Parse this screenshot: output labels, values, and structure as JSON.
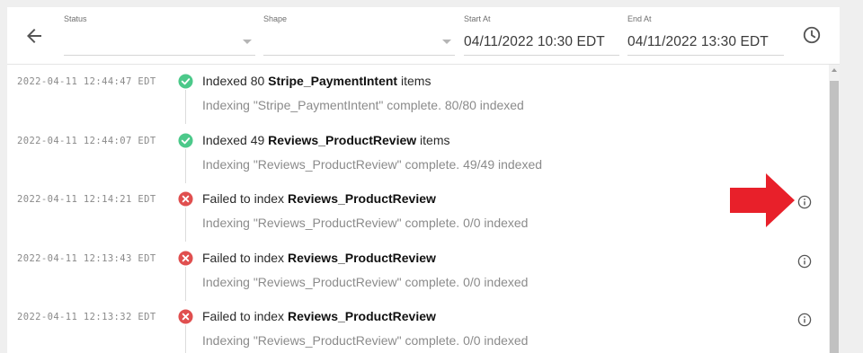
{
  "filters": {
    "status": {
      "label": "Status",
      "value": ""
    },
    "shape": {
      "label": "Shape",
      "value": ""
    },
    "start_at": {
      "label": "Start At",
      "value": "04/11/2022 10:30 EDT"
    },
    "end_at": {
      "label": "End At",
      "value": "04/11/2022 13:30 EDT"
    }
  },
  "icons": {
    "back": "arrow-left-icon",
    "clock": "clock-icon",
    "success": "check-circle-icon",
    "error": "x-circle-icon",
    "info": "info-circle-icon"
  },
  "colors": {
    "success": "#4cc98a",
    "error": "#e04f4f",
    "annotation_arrow": "#e8202a"
  },
  "logs": [
    {
      "timestamp": "2022-04-11 12:44:47 EDT",
      "status": "success",
      "message_prefix": "Indexed 80 ",
      "message_entity": "Stripe_PaymentIntent",
      "message_suffix": " items",
      "detail": "Indexing \"Stripe_PaymentIntent\" complete. 80/80 indexed",
      "has_info": false
    },
    {
      "timestamp": "2022-04-11 12:44:07 EDT",
      "status": "success",
      "message_prefix": "Indexed 49 ",
      "message_entity": "Reviews_ProductReview",
      "message_suffix": " items",
      "detail": "Indexing \"Reviews_ProductReview\" complete. 49/49 indexed",
      "has_info": false
    },
    {
      "timestamp": "2022-04-11 12:14:21 EDT",
      "status": "error",
      "message_prefix": "Failed to index ",
      "message_entity": "Reviews_ProductReview",
      "message_suffix": "",
      "detail": "Indexing \"Reviews_ProductReview\" complete. 0/0 indexed",
      "has_info": true
    },
    {
      "timestamp": "2022-04-11 12:13:43 EDT",
      "status": "error",
      "message_prefix": "Failed to index ",
      "message_entity": "Reviews_ProductReview",
      "message_suffix": "",
      "detail": "Indexing \"Reviews_ProductReview\" complete. 0/0 indexed",
      "has_info": true
    },
    {
      "timestamp": "2022-04-11 12:13:32 EDT",
      "status": "error",
      "message_prefix": "Failed to index ",
      "message_entity": "Reviews_ProductReview",
      "message_suffix": "",
      "detail": "Indexing \"Reviews_ProductReview\" complete. 0/0 indexed",
      "has_info": true
    }
  ]
}
